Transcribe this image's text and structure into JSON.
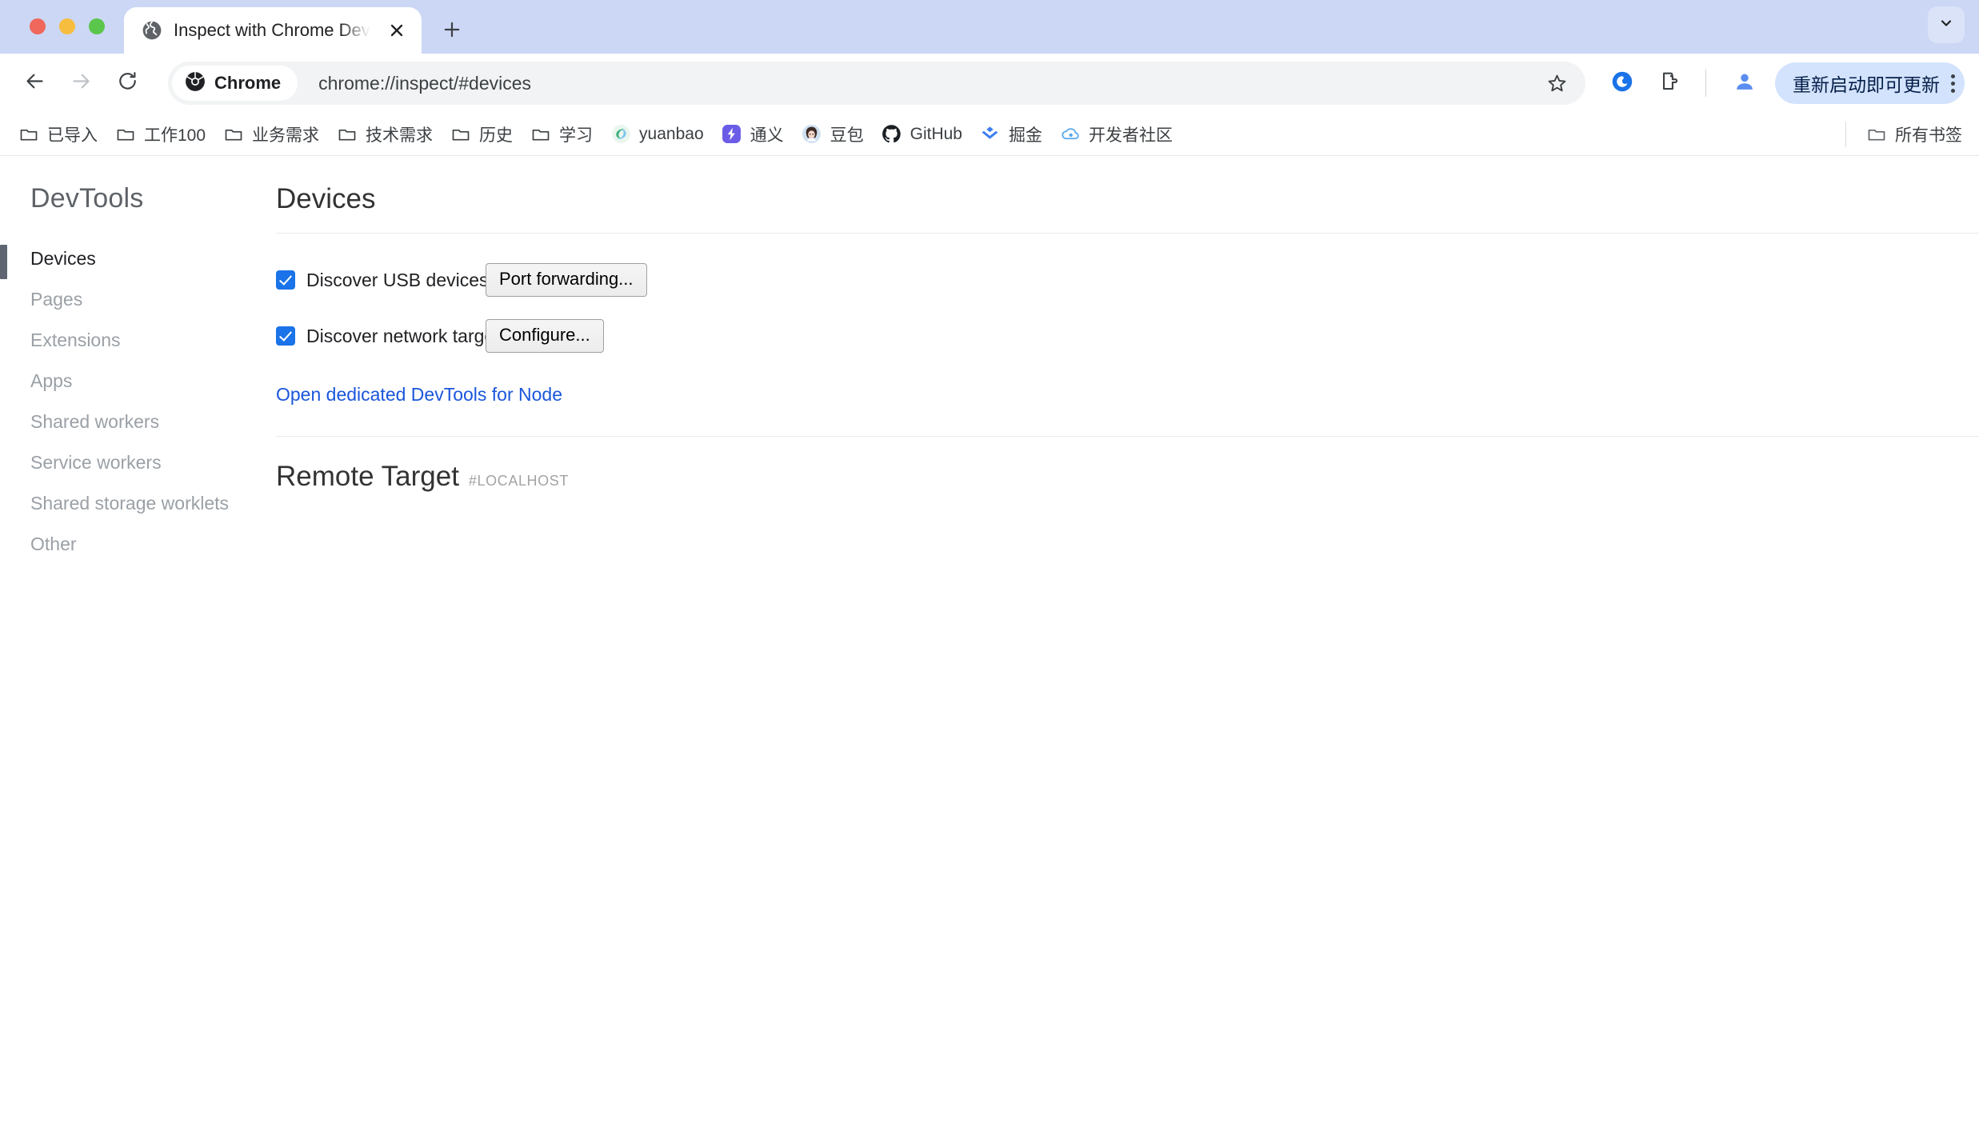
{
  "window": {
    "controls": [
      {
        "name": "close",
        "color": "#f0675c"
      },
      {
        "name": "minimize",
        "color": "#f6bd3f"
      },
      {
        "name": "maximize",
        "color": "#5bc64c"
      }
    ]
  },
  "tabstrip": {
    "tabs": [
      {
        "title": "Inspect with Chrome Develop",
        "favicon": "globe-icon",
        "active": true
      }
    ],
    "new_tab_label": "+",
    "tab_search_icon": "chevron-down-icon"
  },
  "toolbar": {
    "back_icon": "arrow-left-icon",
    "forward_icon": "arrow-right-icon",
    "reload_icon": "reload-icon",
    "chip_label": "Chrome",
    "chip_icon": "chrome-logo-icon",
    "url": "chrome://inspect/#devices",
    "bookmark_icon": "star-icon",
    "actions": [
      {
        "name": "browser-assistant-icon"
      },
      {
        "name": "extensions-puzzle-icon"
      }
    ],
    "profile_icon": "profile-avatar-icon",
    "update_label": "重新启动即可更新",
    "menu_icon": "three-dot-menu-icon"
  },
  "bookmarks": {
    "items": [
      {
        "label": "已导入",
        "icon": "folder-icon"
      },
      {
        "label": "工作100",
        "icon": "folder-icon"
      },
      {
        "label": "业务需求",
        "icon": "folder-icon"
      },
      {
        "label": "技术需求",
        "icon": "folder-icon"
      },
      {
        "label": "历史",
        "icon": "folder-icon"
      },
      {
        "label": "学习",
        "icon": "folder-icon"
      },
      {
        "label": "yuanbao",
        "icon": "yuanbao-favicon"
      },
      {
        "label": "通义",
        "icon": "tongyi-favicon"
      },
      {
        "label": "豆包",
        "icon": "doubao-favicon"
      },
      {
        "label": "GitHub",
        "icon": "github-favicon"
      },
      {
        "label": "掘金",
        "icon": "juejin-favicon"
      },
      {
        "label": "开发者社区",
        "icon": "devcommunity-favicon"
      }
    ],
    "all_bookmarks_label": "所有书签",
    "all_bookmarks_icon": "folder-icon"
  },
  "devtools": {
    "title": "DevTools",
    "sidebar": [
      {
        "label": "Devices",
        "active": true
      },
      {
        "label": "Pages",
        "active": false
      },
      {
        "label": "Extensions",
        "active": false
      },
      {
        "label": "Apps",
        "active": false
      },
      {
        "label": "Shared workers",
        "active": false
      },
      {
        "label": "Service workers",
        "active": false
      },
      {
        "label": "Shared storage worklets",
        "active": false
      },
      {
        "label": "Other",
        "active": false
      }
    ],
    "devices": {
      "heading": "Devices",
      "discover_usb": {
        "label": "Discover USB devices",
        "checked": true,
        "button": "Port forwarding..."
      },
      "discover_network": {
        "label": "Discover network targets",
        "checked": true,
        "button": "Configure..."
      },
      "node_link": "Open dedicated DevTools for Node",
      "remote_target_title": "Remote Target",
      "remote_target_host": "#LOCALHOST"
    }
  },
  "colors": {
    "tabstrip_bg": "#ccd7f5",
    "accent_blue": "#1a73e8",
    "link_blue": "#1a56db",
    "update_pill_bg": "#d3e3fd"
  }
}
